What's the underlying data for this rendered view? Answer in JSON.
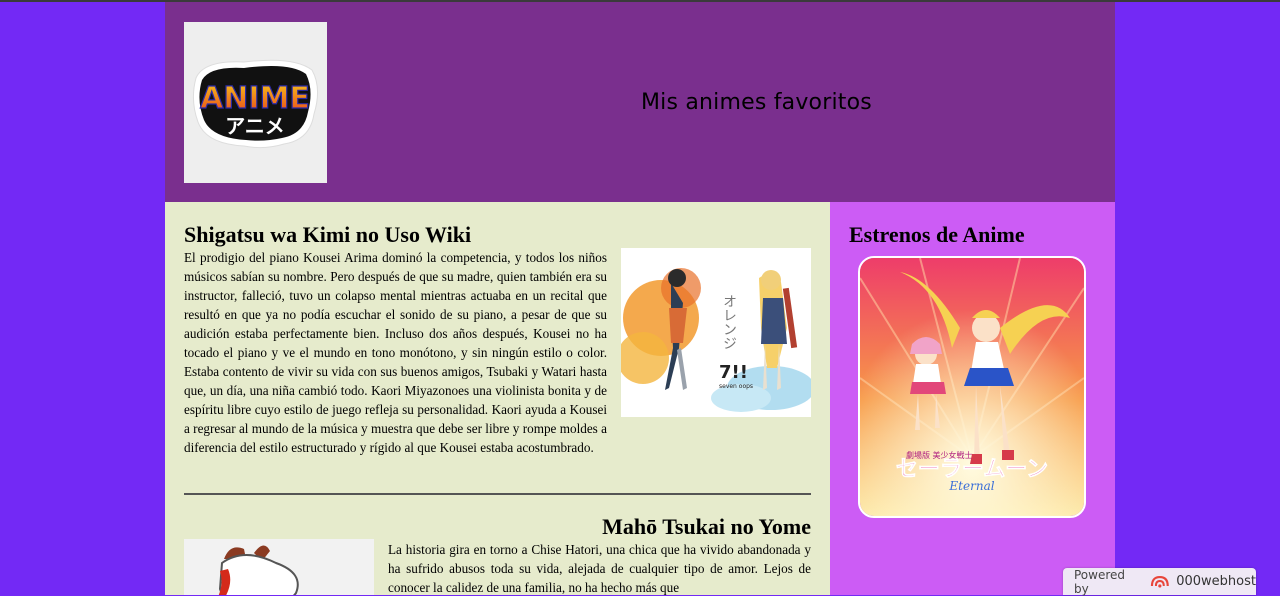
{
  "header": {
    "logo_text": "ANIME",
    "logo_subtext": "アニメ",
    "site_title": "Mis animes favoritos"
  },
  "main": {
    "article1": {
      "title": "Shigatsu wa Kimi no Uso Wiki",
      "image_text": "7!!",
      "image_subtext": "seven oops",
      "image_vertical": "オレンジ",
      "body": "El prodigio del piano Kousei Arima dominó la competencia, y todos los niños músicos sabían su nombre. Pero después de que su madre, quien también era su instructor, falleció, tuvo un colapso mental mientras actuaba en un recital que resultó en que ya no podía escuchar el sonido de su piano, a pesar de que su audición estaba perfectamente bien. Incluso dos años después, Kousei no ha tocado el piano y ve el mundo en tono monótono, y sin ningún estilo o color. Estaba contento de vivir su vida con sus buenos amigos, Tsubaki y Watari hasta que, un día, una niña cambió todo. Kaori Miyazonoes una violinista bonita y de espíritu libre cuyo estilo de juego refleja su personalidad. Kaori ayuda a Kousei a regresar al mundo de la música y muestra que debe ser libre y rompe moldes a diferencia del estilo estructurado y rígido al que Kousei estaba acostumbrado."
    },
    "article2": {
      "title": "Mahō Tsukai no Yome",
      "body": "La historia gira en torno a Chise Hatori, una chica que ha vivido abandonada y ha sufrido abusos toda su vida, alejada de cualquier tipo de amor. Lejos de conocer la calidez de una familia, no ha hecho más que"
    }
  },
  "aside": {
    "title": "Estrenos de Anime",
    "poster_title": "セーラームーン",
    "poster_subtitle": "Eternal",
    "poster_small": "劇場版 美少女戦士"
  },
  "footer_badge": {
    "prefix": "Powered by",
    "brand": "000webhost"
  },
  "colors": {
    "page_bg": "#7329f5",
    "header_bg": "#7a2f8e",
    "main_bg": "#e6ebcc",
    "aside_bg": "#cc5cf5"
  }
}
